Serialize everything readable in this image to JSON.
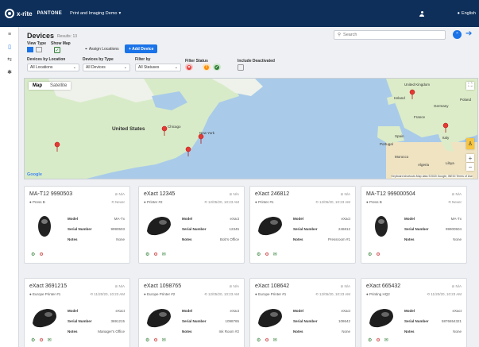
{
  "header": {
    "brand": "x-rite",
    "pantone": "PANTONE",
    "workspace": "Print and Imaging Demo",
    "language": "English"
  },
  "page": {
    "title": "Devices",
    "results": "Results: 13",
    "search_placeholder": "Search",
    "view_type_label": "View Type",
    "show_map_label": "Show Map",
    "assign_label": "Assign Locations",
    "add_label": "+ Add Device",
    "filters": {
      "location_label": "Devices by Location",
      "location_value": "All Locations",
      "type_label": "Devices by Type",
      "type_value": "All Devices",
      "filter_label": "Filter by",
      "filter_value": "All Statuses",
      "status_label": "Filter Status",
      "deactivated_label": "Include Deactivated"
    }
  },
  "map": {
    "tab_map": "Map",
    "tab_satellite": "Satellite",
    "labels": {
      "united_states": "United States",
      "ireland": "Ireland",
      "united_kingdom": "United Kingdom",
      "germany": "Germany",
      "france": "France",
      "italy": "Italy",
      "spain": "Spain",
      "portugal": "Portugal",
      "poland": "Poland",
      "new_york": "New York",
      "chicago": "Chicago",
      "morocco": "Morocco",
      "libya": "Libya",
      "algeria": "Algeria"
    },
    "google": "Google",
    "attribution": "Keyboard shortcuts   Map data ©2020 Google, INEGI   Terms of Use"
  },
  "cards": [
    {
      "title": "MA-T12 9990503",
      "status": "N/A",
      "sub": "Press B",
      "date": "Never",
      "model": "MA-Tx",
      "serial": "9990503",
      "notes": "None",
      "acts": 2
    },
    {
      "title": "eXact 12345",
      "status": "N/A",
      "sub": "Printer #2",
      "date": "12/05/20, 10:23 AM",
      "model": "eXact",
      "serial": "12345",
      "notes": "Bob's Office",
      "acts": 3
    },
    {
      "title": "eXact 246812",
      "status": "N/A",
      "sub": "Printer #1",
      "date": "12/05/20, 10:23 AM",
      "model": "eXact",
      "serial": "246812",
      "notes": "Pressroom #1",
      "acts": 3
    },
    {
      "title": "MA-T12 999000504",
      "status": "N/A",
      "sub": "Press B",
      "date": "Never",
      "model": "MA-Tx",
      "serial": "99900504",
      "notes": "None",
      "acts": 2
    },
    {
      "title": "eXact 3691215",
      "status": "N/A",
      "sub": "Europe Printer #1",
      "date": "11/20/20, 10:23 AM",
      "model": "eXact",
      "serial": "3691215",
      "notes": "Manager's Office",
      "acts": 3
    },
    {
      "title": "eXact 1098765",
      "status": "N/A",
      "sub": "Europe Printer #2",
      "date": "12/05/20, 10:23 AM",
      "model": "eXact",
      "serial": "1098765",
      "notes": "Ink Room #2",
      "acts": 3
    },
    {
      "title": "eXact 108642",
      "status": "N/A",
      "sub": "Europe Printer #1",
      "date": "12/05/20, 10:23 AM",
      "model": "eXact",
      "serial": "108642",
      "notes": "None",
      "acts": 3
    },
    {
      "title": "eXact 665432",
      "status": "N/A",
      "sub": "Printing HQ2",
      "date": "11/20/20, 10:23 AM",
      "model": "eXact",
      "serial": "5876654321",
      "notes": "None",
      "acts": 3
    }
  ],
  "card_labels": {
    "model": "Model",
    "serial": "Serial Number",
    "notes": "Notes"
  },
  "colors": {
    "header": "#0d2f5a",
    "accent": "#1a73e8",
    "ok": "#2e7d32",
    "error": "#e53935",
    "warn": "#fb8c00"
  }
}
